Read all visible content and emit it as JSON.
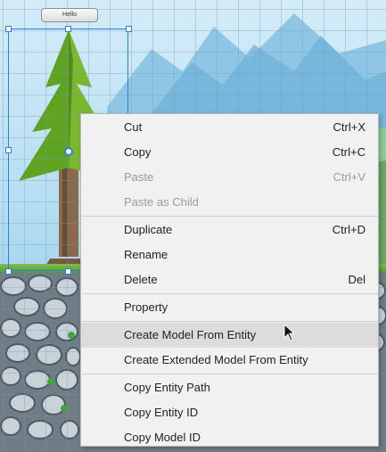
{
  "scene": {
    "entity_tag": "Hello",
    "colors": {
      "selection": "#2c7fd4",
      "sky": "#b6def3",
      "grass": "#7cc24a"
    }
  },
  "menu": {
    "groups": [
      [
        {
          "name": "menu-item-cut",
          "label": "Cut",
          "shortcut": "Ctrl+X",
          "enabled": true
        },
        {
          "name": "menu-item-copy",
          "label": "Copy",
          "shortcut": "Ctrl+C",
          "enabled": true
        },
        {
          "name": "menu-item-paste",
          "label": "Paste",
          "shortcut": "Ctrl+V",
          "enabled": false
        },
        {
          "name": "menu-item-paste-as-child",
          "label": "Paste as Child",
          "shortcut": "",
          "enabled": false
        }
      ],
      [
        {
          "name": "menu-item-duplicate",
          "label": "Duplicate",
          "shortcut": "Ctrl+D",
          "enabled": true
        },
        {
          "name": "menu-item-rename",
          "label": "Rename",
          "shortcut": "",
          "enabled": true
        },
        {
          "name": "menu-item-delete",
          "label": "Delete",
          "shortcut": "Del",
          "enabled": true
        }
      ],
      [
        {
          "name": "menu-item-property",
          "label": "Property",
          "shortcut": "",
          "enabled": true
        }
      ],
      [
        {
          "name": "menu-item-create-model-from-entity",
          "label": "Create Model From Entity",
          "shortcut": "",
          "enabled": true,
          "hover": true
        },
        {
          "name": "menu-item-create-extended-model-from-entity",
          "label": "Create Extended Model From Entity",
          "shortcut": "",
          "enabled": true
        }
      ],
      [
        {
          "name": "menu-item-copy-entity-path",
          "label": "Copy Entity Path",
          "shortcut": "",
          "enabled": true
        },
        {
          "name": "menu-item-copy-entity-id",
          "label": "Copy Entity ID",
          "shortcut": "",
          "enabled": true
        },
        {
          "name": "menu-item-copy-model-id",
          "label": "Copy Model ID",
          "shortcut": "",
          "enabled": true
        }
      ]
    ]
  }
}
